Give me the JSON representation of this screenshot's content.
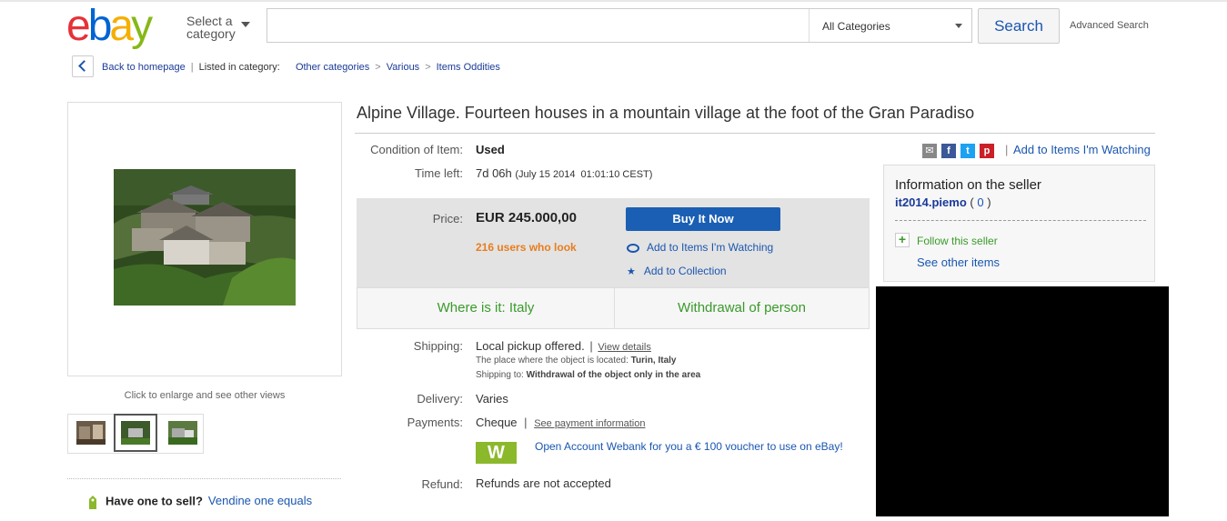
{
  "colors": {
    "brand_blue": "#1a56b0",
    "green": "#3a9a2a",
    "orange": "#e87d1e",
    "buy_button": "#1a5fb4",
    "ad_block": "#000000"
  },
  "header": {
    "logo": "ebay",
    "select_category": [
      "Select a",
      "category"
    ],
    "search_placeholder": "",
    "category_dropdown": "All Categories",
    "search_button": "Search",
    "advanced_search": "Advanced Search"
  },
  "breadcrumb": {
    "back": "Back to homepage",
    "listed_in": "Listed in category:",
    "path": [
      "Other categories",
      "Various",
      "Items Oddities"
    ],
    "separator": ">",
    "pipe": "|"
  },
  "gallery": {
    "enlarge_text": "Click to enlarge and see other views",
    "thumbnail_count": 3,
    "selected_thumbnail": 2
  },
  "sell": {
    "question": "Have one to sell?",
    "link": "Vendine one equals"
  },
  "item": {
    "title": "Alpine Village. Fourteen houses in a mountain village at the foot of the Gran Paradiso",
    "condition_label": "Condition of Item:",
    "condition_value": "Used",
    "time_left_label": "Time left:",
    "time_left_value": "7d 06h",
    "time_left_date": "(July 15 2014  01:01:10 CEST)",
    "price_label": "Price:",
    "price_value": "EUR 245.000,00",
    "watchers": "216 users who look",
    "buy_now": "Buy It Now",
    "add_watch": "Add to Items I'm Watching",
    "add_collection": "Add to Collection",
    "where": "Where is it: Italy",
    "withdrawal": "Withdrawal of person",
    "shipping_label": "Shipping:",
    "shipping_value": "Local pickup offered.",
    "shipping_pipe": "|",
    "view_details": "View details",
    "location_label": "The place where the object is located:",
    "location_value": "Turin, Italy",
    "shipping_to_label": "Shipping to:",
    "shipping_to_value": "Withdrawal of the object only in the area",
    "delivery_label": "Delivery:",
    "delivery_value": "Varies",
    "payments_label": "Payments:",
    "payments_value": "Cheque",
    "payments_pipe": "|",
    "payment_info": "See payment information",
    "webank_logo": "W",
    "webank_offer": "Open Account Webank for you a € 100 voucher to use on eBay!",
    "refund_label": "Refund:",
    "refund_value": "Refunds are not accepted"
  },
  "social": {
    "icons": [
      "email-icon",
      "facebook-icon",
      "twitter-icon",
      "pinterest-icon"
    ],
    "pipe": "|",
    "watch_link": "Add to Items I'm Watching"
  },
  "seller": {
    "heading": "Information on the seller",
    "name": "it2014.piemo",
    "feedback_open": "(",
    "feedback": "0",
    "feedback_close": ")",
    "follow": "Follow this seller",
    "see_items": "See other items"
  }
}
